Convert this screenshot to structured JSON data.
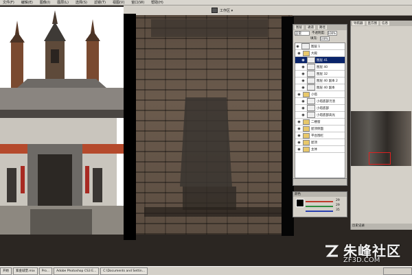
{
  "menubar": {
    "items": [
      "文件(F)",
      "编辑(E)",
      "图像(I)",
      "图层(L)",
      "选择(S)",
      "滤镜(T)",
      "视图(V)",
      "窗口(W)",
      "帮助(H)"
    ]
  },
  "options": {
    "workspace_label": "工作区 ▾"
  },
  "layers_panel": {
    "tabs": [
      "图层",
      "通道",
      "路径"
    ],
    "blend_mode": "正常",
    "opacity_label": "不透明度:",
    "opacity": "100%",
    "fill_label": "填充:",
    "fill": "100%",
    "layers": [
      {
        "name": "图层 1",
        "type": "layer",
        "indent": false,
        "selected": false
      },
      {
        "name": "大殿",
        "type": "folder",
        "indent": false,
        "selected": false
      },
      {
        "name": "图层 41",
        "type": "layer",
        "indent": true,
        "selected": true
      },
      {
        "name": "图层 40",
        "type": "layer",
        "indent": true,
        "selected": false
      },
      {
        "name": "图层 32",
        "type": "layer",
        "indent": true,
        "selected": false
      },
      {
        "name": "图层 40 副本 2",
        "type": "layer",
        "indent": true,
        "selected": false
      },
      {
        "name": "图层 40 副本",
        "type": "layer",
        "indent": true,
        "selected": false
      },
      {
        "name": "小塔",
        "type": "folder",
        "indent": false,
        "selected": false
      },
      {
        "name": "小塔底部污渍",
        "type": "layer",
        "indent": true,
        "selected": false
      },
      {
        "name": "小塔底部",
        "type": "layer",
        "indent": true,
        "selected": false
      },
      {
        "name": "小塔底部高光",
        "type": "layer",
        "indent": true,
        "selected": false
      },
      {
        "name": "二楼窗",
        "type": "folder",
        "indent": false,
        "selected": false
      },
      {
        "name": "屋顶侧面",
        "type": "folder",
        "indent": false,
        "selected": false
      },
      {
        "name": "平台围栏",
        "type": "folder",
        "indent": false,
        "selected": false
      },
      {
        "name": "屋顶",
        "type": "folder",
        "indent": false,
        "selected": false
      },
      {
        "name": "主体",
        "type": "folder",
        "indent": false,
        "selected": false
      }
    ]
  },
  "color_panel": {
    "tab": "颜色",
    "r": "29",
    "g": "29",
    "b": "35"
  },
  "navigator": {
    "tabs": [
      "导航器",
      "直方图",
      "信息"
    ],
    "history_tab": "历史记录"
  },
  "taskbar": {
    "items": [
      "开始",
      "紫金城堡.mix",
      "Pro...",
      "Adobe Photoshop CS3 E...",
      "C:\\Documents and Settin..."
    ]
  },
  "watermark": {
    "brand": "朱峰社区",
    "url": "ZF3D.COM"
  },
  "colors": {
    "selection": "#0a246a",
    "panel": "#d4d0c8"
  }
}
